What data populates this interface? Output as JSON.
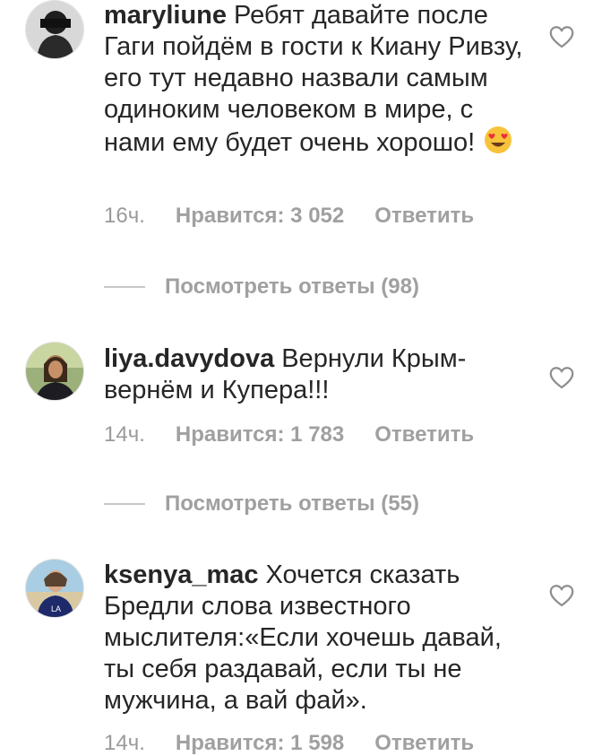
{
  "comments": [
    {
      "username": "maryliune",
      "text": "Ребят давайте после Гаги пойдём в гости к Киану Ривзу, его тут недавно назвали самым одиноким человеком в мире, с нами ему будет очень хорошо!",
      "emoji": "heart-eyes-emoji",
      "time": "16ч.",
      "likes": "Нравится: 3 052",
      "reply": "Ответить",
      "view_replies": "Посмотреть ответы (98)"
    },
    {
      "username": "liya.davydova",
      "text": "Вернули Крым- вернём и Купера!!!",
      "time": "14ч.",
      "likes": "Нравится: 1 783",
      "reply": "Ответить",
      "view_replies": "Посмотреть ответы (55)"
    },
    {
      "username": "ksenya_mac",
      "text": "Хочется сказать Бредли слова известного мыслителя:«Если хочешь давай, ты себя раздавай, если ты не мужчина, а вай фай».",
      "time": "14ч.",
      "likes": "Нравится: 1 598",
      "reply": "Ответить"
    }
  ],
  "icons": {
    "like": "heart-outline-icon"
  },
  "colors": {
    "text": "#262626",
    "meta": "#9a9a9a",
    "emoji_face": "#f7c33a",
    "emoji_heart": "#e8323a"
  }
}
